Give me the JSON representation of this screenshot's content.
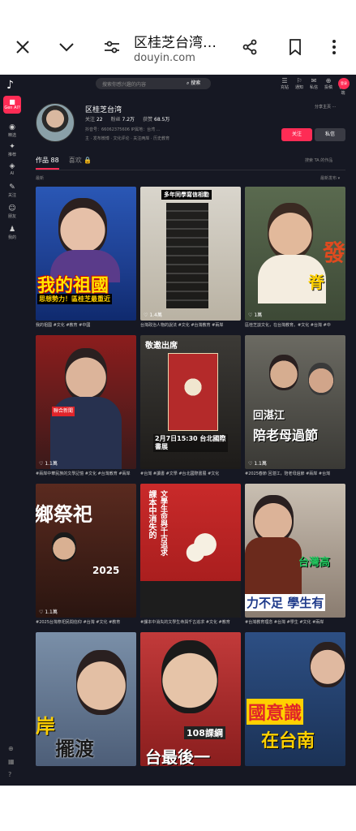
{
  "browser": {
    "title": "区桂芝台湾…",
    "url": "douyin.com",
    "icons": [
      "close-icon",
      "chevron-down-icon",
      "site-settings-icon",
      "share-icon",
      "bookmark-icon",
      "more-vert-icon"
    ]
  },
  "sidebar": {
    "logo": "♪",
    "active": "Gen AI?",
    "items": [
      "精选",
      "推荐",
      "AI",
      "关注",
      "朋友",
      "我的"
    ]
  },
  "topbar": {
    "search_placeholder": "搜索你感兴趣的内容",
    "search_button": "搜索",
    "icons": [
      "充钻",
      "通知",
      "私信",
      "投稿",
      "客户端"
    ],
    "login": "登录"
  },
  "profile": {
    "name": "区桂芝台湾",
    "follow_label": "关注",
    "follow_count": "22",
    "fans_label": "粉丝",
    "fans_count": "7.2万",
    "likes_label": "获赞",
    "likes_count": "68.5万",
    "meta_line1": "抖音号：66062375606    IP属地：台湾    ...",
    "meta_line2": "主 · 发布微博 · 文化评论 · 关注两岸 · 历史教育",
    "share": "分享主页 ···",
    "follow_button": "关注",
    "message_button": "私信"
  },
  "tabs": {
    "works": "作品 88",
    "likes": "喜欢 🔒",
    "search": "搜索 TA 的作品"
  },
  "filter": "最新",
  "sort": "最新发布 ▾",
  "videos": [
    {
      "overlay": "我的祖國",
      "sub": "思想勢力！區桂芝最重近",
      "likes": "",
      "caption": "我的祖國 #文化 #教育 #中國"
    },
    {
      "overlay": "多年同學寫信相勸",
      "sub": "",
      "likes": "1.4萬",
      "caption": "台灣政治人物的說法 #文化 #台灣教育 #兩岸"
    },
    {
      "overlay": "發",
      "sub": "脊",
      "likes": "1萬",
      "caption": "區桂芝談文化，在台灣教育。#文化 #台灣 #中"
    },
    {
      "overlay": "",
      "sub": "",
      "likes": "1.1萬",
      "caption": "#兩岸中華民族的文學記憶 #文化 #台灣教育 #兩岸"
    },
    {
      "overlay": "敬邀出席",
      "sub": "2月7日15:30 台北國際書展",
      "likes": "",
      "caption": "#台灣 #讀書 #文學 #台北國際書展 #文化"
    },
    {
      "overlay": "回湛江",
      "sub": "陪老母過節",
      "likes": "1.1萬",
      "caption": "#2025春節 回湛江，陪老母過節 #兩岸 #台灣"
    },
    {
      "overlay": "鄉祭祀",
      "sub": "2025",
      "likes": "1.1萬",
      "caption": "#2025台灣祭祀民間信仰 #台灣 #文化 #教育"
    },
    {
      "overlay": "課本中消失的",
      "sub": "文學生命與千古追求",
      "likes": "",
      "caption": "#課本中消失的文學生命與千古追求 #文化 #教育"
    },
    {
      "overlay": "台灣高",
      "sub": "力不足 學生有",
      "likes": "",
      "caption": "#台灣教育理念 #台灣 #學生 #文化 #兩岸"
    },
    {
      "overlay": "岸",
      "sub": "擺渡",
      "likes": "",
      "caption": ""
    },
    {
      "overlay": "108課綱",
      "sub": "台最後一",
      "likes": "",
      "caption": ""
    },
    {
      "overlay": "國意識",
      "sub": "在台南",
      "likes": "",
      "caption": ""
    }
  ],
  "colors": {
    "accent": "#fe2c55",
    "bg": "#161823"
  }
}
